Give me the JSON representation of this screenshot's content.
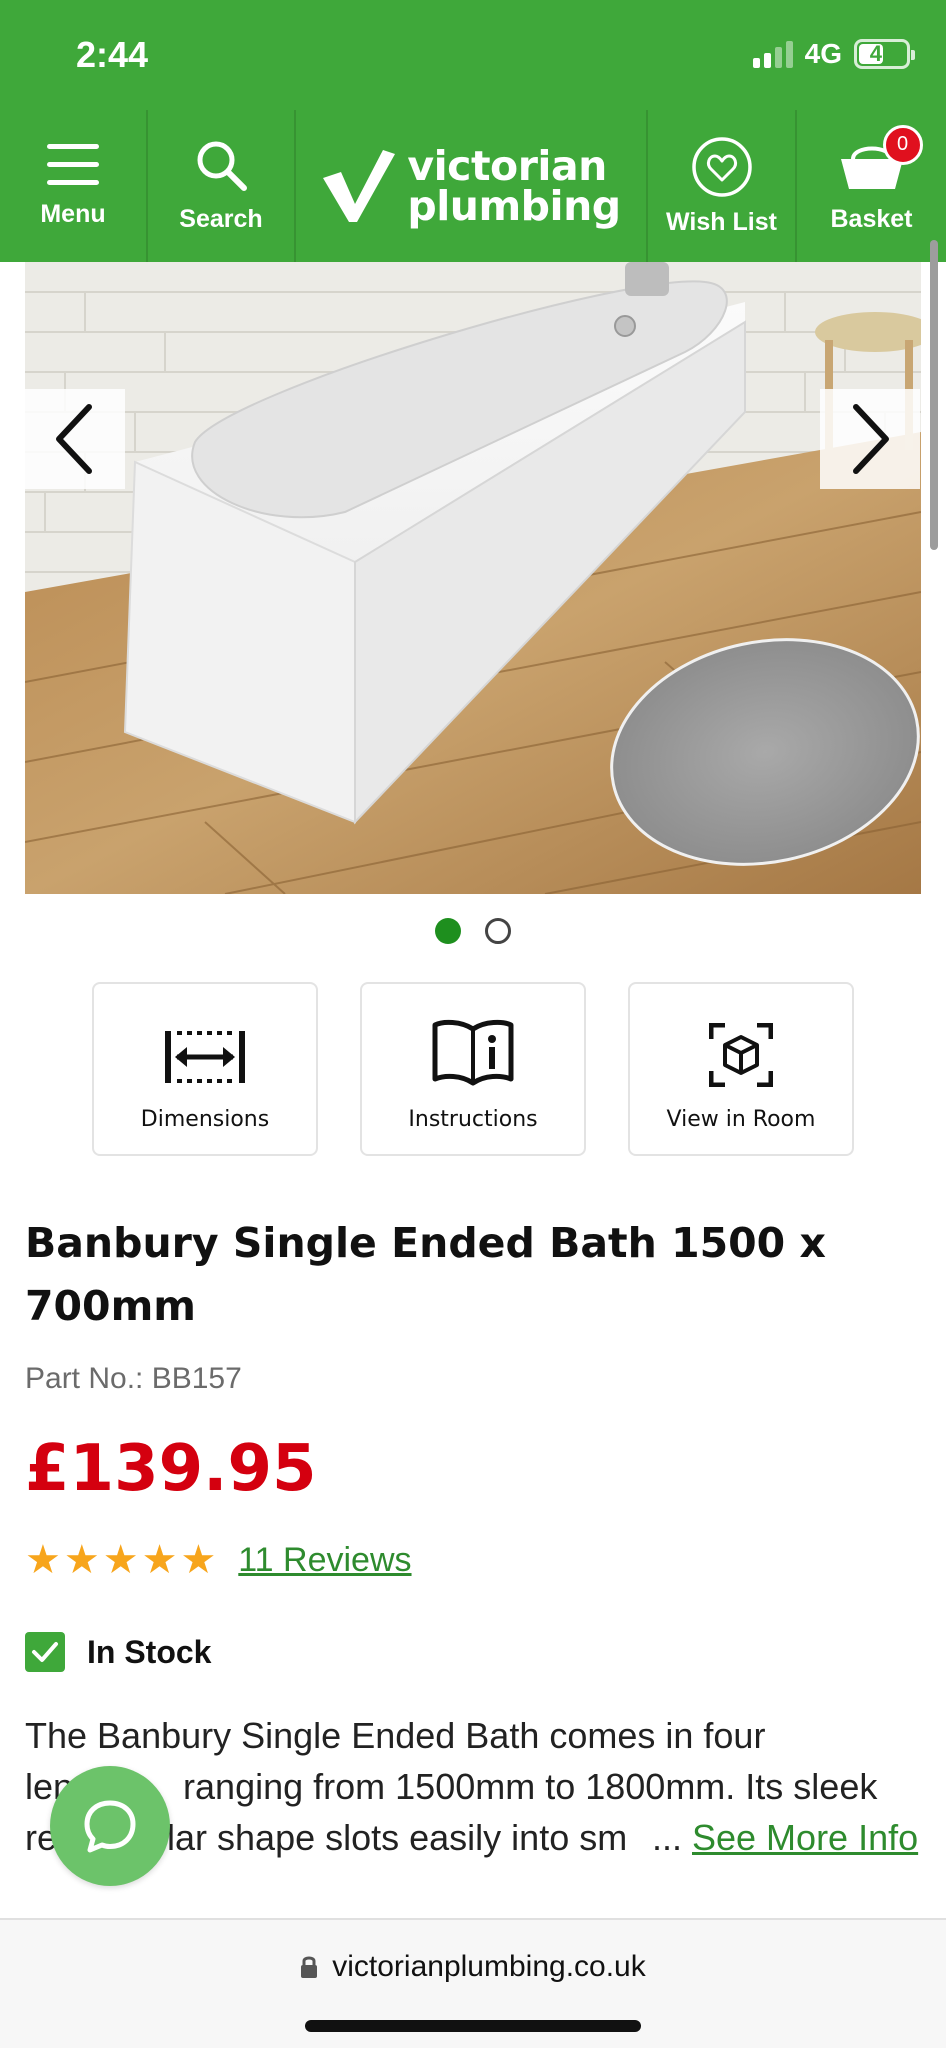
{
  "status_bar": {
    "time": "2:44",
    "network": "4G",
    "battery": "47"
  },
  "nav": {
    "menu_label": "Menu",
    "search_label": "Search",
    "logo_line1": "victorian",
    "logo_line2": "plumbing",
    "wishlist_label": "Wish List",
    "basket_label": "Basket",
    "basket_count": "0"
  },
  "carousel": {
    "image_count": 2,
    "active_index": 0
  },
  "features": {
    "dimensions": "Dimensions",
    "instructions": "Instructions",
    "view_in_room": "View in Room"
  },
  "product": {
    "title": "Banbury Single Ended Bath 1500 x 700mm",
    "part_no": "Part No.: BB157",
    "price": "£139.95",
    "rating_stars": 5,
    "reviews_link": "11 Reviews",
    "stock": "In Stock",
    "description_line1": "The Banbury Single Ended Bath comes in four",
    "description_line2_a": "len",
    "description_line2_b": "ranging from 1500mm to 1800mm. Its sleek",
    "description_line3_a": "re",
    "description_line3_b": "lar shape slots easily into sm",
    "description_ellipsis": "...",
    "see_more": "See More Info"
  },
  "browser": {
    "url": "victorianplumbing.co.uk"
  },
  "colors": {
    "brand_green": "#3fa83a",
    "price_red": "#d4000f",
    "link_green": "#2e8b2e",
    "star_orange": "#f7a51c"
  }
}
